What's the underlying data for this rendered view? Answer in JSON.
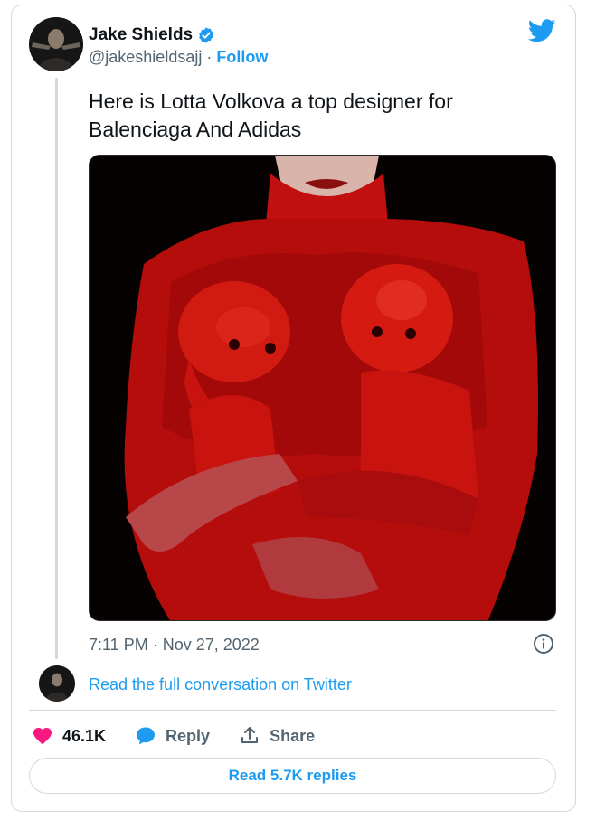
{
  "author": {
    "name": "Jake Shields",
    "handle": "@jakeshieldsajj",
    "separator": " · ",
    "follow_label": "Follow",
    "verified": true
  },
  "tweet": {
    "text": "Here is Lotta Volkova a top designer for Balenciaga And Adidas",
    "timestamp": "7:11 PM · Nov 27, 2022"
  },
  "conversation_link": "Read the full conversation on Twitter",
  "actions": {
    "likes": "46.1K",
    "reply_label": "Reply",
    "share_label": "Share"
  },
  "replies_button": "Read 5.7K replies",
  "colors": {
    "accent": "#1d9bf0",
    "like": "#f91880",
    "muted": "#536471",
    "border": "#cfd9de"
  },
  "icons": {
    "brand": "twitter-bird-icon",
    "verified": "verified-badge-icon",
    "info": "info-icon",
    "like": "heart-icon",
    "reply": "speech-bubble-icon",
    "share": "upload-icon"
  }
}
